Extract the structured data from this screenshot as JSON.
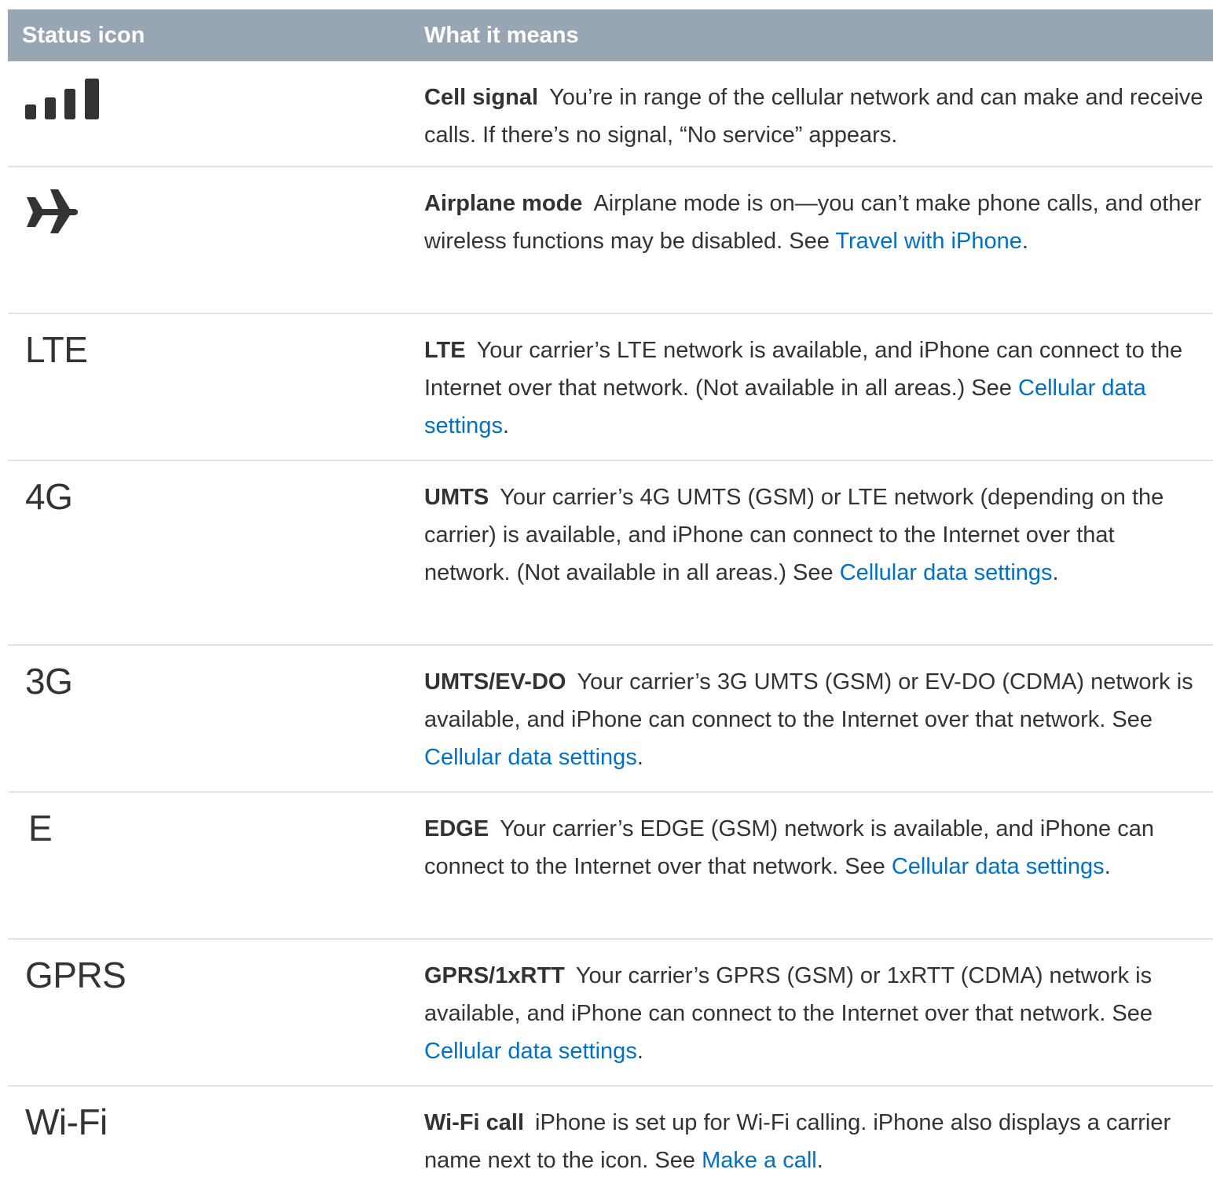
{
  "header": {
    "col1": "Status icon",
    "col2": "What it means"
  },
  "rows": [
    {
      "icon_name": "cell-signal-icon",
      "icon_text": "",
      "title": "Cell signal",
      "text": "You’re in range of the cellular network and can make and receive calls. If there’s no signal, “No service” appears.",
      "link": "",
      "after": ""
    },
    {
      "icon_name": "airplane-icon",
      "icon_text": "",
      "title": "Airplane mode",
      "text": "Airplane mode is on—you can’t make phone calls, and other wireless functions may be disabled. See ",
      "link": "Travel with iPhone",
      "after": "."
    },
    {
      "icon_name": "lte-icon",
      "icon_text": "LTE",
      "title": "LTE",
      "text": "Your carrier’s LTE network is available, and iPhone can connect to the Internet over that network. (Not available in all areas.) See ",
      "link": "Cellular data settings",
      "after": "."
    },
    {
      "icon_name": "4g-icon",
      "icon_text": "4G",
      "title": "UMTS",
      "text": "Your carrier’s 4G UMTS (GSM) or LTE network (depending on the carrier) is available, and iPhone can connect to the Internet over that network. (Not available in all areas.) See ",
      "link": "Cellular data settings",
      "after": "."
    },
    {
      "icon_name": "3g-icon",
      "icon_text": "3G",
      "title": "UMTS/EV-DO",
      "text": "Your carrier’s 3G UMTS (GSM) or EV-DO (CDMA) network is available, and iPhone can connect to the Internet over that network. See ",
      "link": "Cellular data settings",
      "after": "."
    },
    {
      "icon_name": "edge-icon",
      "icon_text": "E",
      "title": "EDGE",
      "text": "Your carrier’s EDGE (GSM) network is available, and iPhone can connect to the Internet over that network. See ",
      "link": "Cellular data settings",
      "after": "."
    },
    {
      "icon_name": "gprs-icon",
      "icon_text": "GPRS",
      "title": "GPRS/1xRTT",
      "text": "Your carrier’s GPRS (GSM) or 1xRTT (CDMA) network is available, and iPhone can connect to the Internet over that network. See ",
      "link": "Cellular data settings",
      "after": "."
    },
    {
      "icon_name": "wifi-call-icon",
      "icon_text": "Wi-Fi",
      "title": "Wi-Fi call",
      "text": "iPhone is set up for Wi-Fi calling. iPhone also displays a carrier name next to the icon. See ",
      "link": "Make a call",
      "after": "."
    }
  ],
  "colors": {
    "header_bg": "#98a6b4",
    "link": "#0070c9",
    "text": "#333333",
    "divider": "#e3e3e3"
  }
}
